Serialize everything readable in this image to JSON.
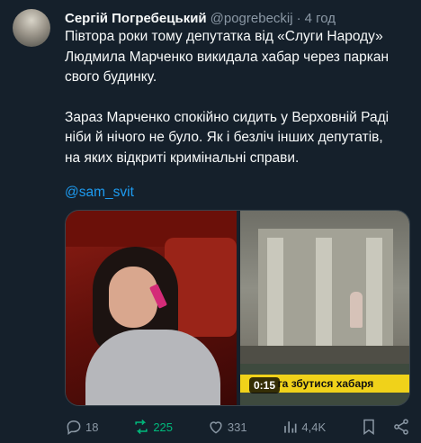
{
  "author": {
    "display_name": "Сергій Погребецький",
    "handle": "@pogrebeckij",
    "separator": "·",
    "time": "4 год"
  },
  "tweet": {
    "paragraphs": [
      "Півтора роки тому депутатка від «Слуги Народу»\nЛюдмила Марченко викидала хабар через паркан\nсвого будинку.",
      "Зараз Марченко спокійно сидить у Верховній Раді\nніби й нічого не було. Як і безліч інших депутатів,\nна яких відкриті кримінальні справи."
    ],
    "mention": "@sam_svit"
  },
  "media": {
    "video_time": "0:15",
    "caption": "га       збутися хабаря"
  },
  "stats": {
    "replies": "18",
    "retweets": "225",
    "likes": "331",
    "views": "4,4K"
  },
  "colors": {
    "background": "#15202b",
    "text": "#f7f9f9",
    "muted": "#8b98a5",
    "link": "#1d9bf0",
    "retweet_active": "#00ba7c"
  },
  "icons": {
    "reply": "speech-bubble",
    "retweet": "retweet-arrows",
    "like": "heart-outline",
    "views": "bar-chart",
    "bookmark": "bookmark",
    "share": "share-nodes"
  }
}
